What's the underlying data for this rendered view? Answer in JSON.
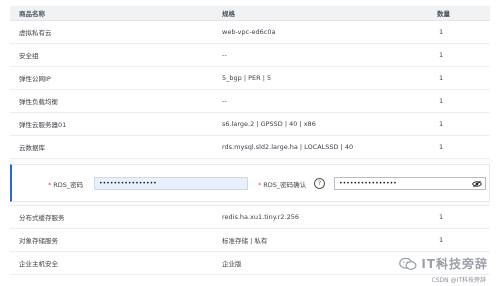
{
  "table": {
    "headers": {
      "name": "商品名称",
      "spec": "规格",
      "qty": "数量"
    },
    "rows_top": [
      {
        "name": "虚拟私有云",
        "spec": "web-vpc-ed6c0a",
        "qty": "1"
      },
      {
        "name": "安全组",
        "spec": "--",
        "qty": "1"
      },
      {
        "name": "弹性公网IP",
        "spec": "5_bgp | PER | 5",
        "qty": "1"
      },
      {
        "name": "弹性负载均衡",
        "spec": "--",
        "qty": "1"
      },
      {
        "name": "弹性云服务器01",
        "spec": "s6.large.2 | GPSSD | 40 | x86",
        "qty": "1"
      },
      {
        "name": "云数据库",
        "spec": "rds.mysql.sld2.large.ha | LOCALSSD | 40",
        "qty": "1"
      }
    ],
    "rows_bottom": [
      {
        "name": "分布式缓存服务",
        "spec": "redis.ha.xu1.tiny.r2.256",
        "qty": "1"
      },
      {
        "name": "对象存储服务",
        "spec": "标准存储 | 私有",
        "qty": "1"
      },
      {
        "name": "企业主机安全",
        "spec": "企业版",
        "qty": "1"
      }
    ]
  },
  "rds": {
    "required_mark": "*",
    "password_label": "RDS_密码",
    "password_value": "••••••••••••••••",
    "confirm_label": "RDS_密码确认",
    "confirm_value": "••••••••••••••••",
    "help_glyph": "?"
  },
  "watermark": {
    "text": "IT科技旁辞",
    "csdn": "CSDN @IT科技旁辞"
  },
  "colors": {
    "accent": "#2a66d9",
    "required": "#e34d41",
    "input_autofill": "#e8f0fe"
  }
}
